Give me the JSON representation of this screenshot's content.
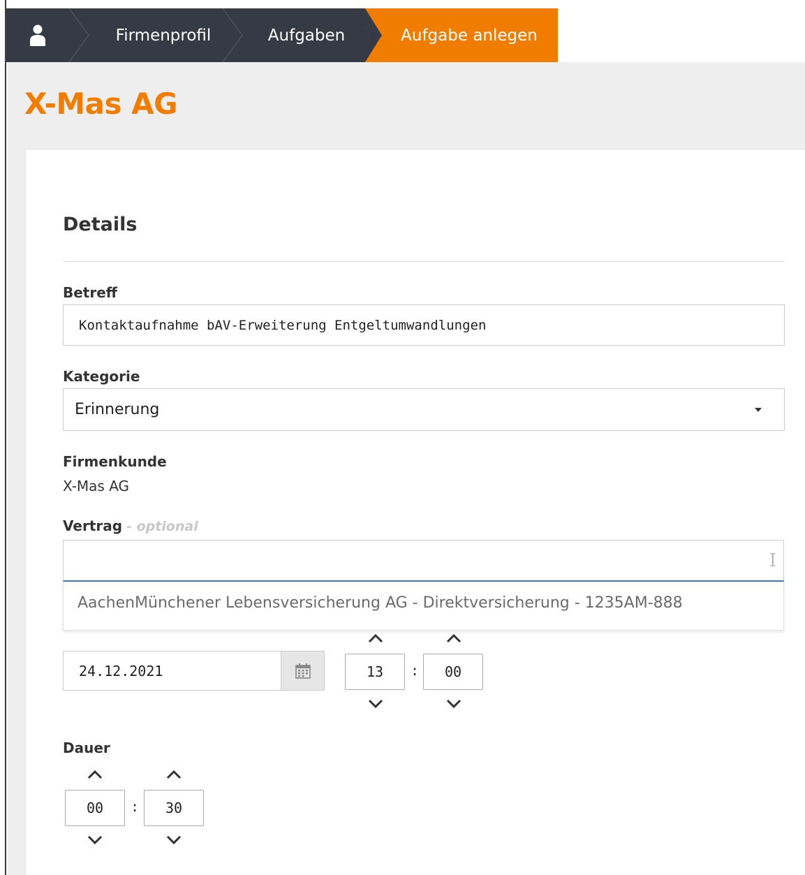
{
  "breadcrumb": {
    "home_icon": "user-icon",
    "items": [
      {
        "label": "Firmenprofil"
      },
      {
        "label": "Aufgaben"
      },
      {
        "label": "Aufgabe anlegen"
      }
    ]
  },
  "colors": {
    "accent": "#f07d00",
    "nav_dark": "#353a44",
    "focus_blue": "#3b78c8"
  },
  "header": {
    "company_name": "X-Mas AG"
  },
  "details": {
    "section_title": "Details",
    "betreff": {
      "label": "Betreff",
      "value": "Kontaktaufnahme bAV-Erweiterung Entgeltumwandlungen"
    },
    "kategorie": {
      "label": "Kategorie",
      "value": "Erinnerung"
    },
    "firmenkunde": {
      "label": "Firmenkunde",
      "value": "X-Mas AG"
    },
    "vertrag": {
      "label": "Vertrag",
      "optional_hint": "- optional",
      "value": "",
      "suggestions": [
        "AachenMünchener Lebensversicherung AG - Direktversicherung - 1235AM-888"
      ]
    },
    "termin": {
      "date": "24.12.2021",
      "calendar_icon": "calendar-icon",
      "hours": "13",
      "minutes": "00",
      "separator": ":"
    },
    "dauer": {
      "label": "Dauer",
      "hours": "00",
      "minutes": "30",
      "separator": ":"
    }
  }
}
